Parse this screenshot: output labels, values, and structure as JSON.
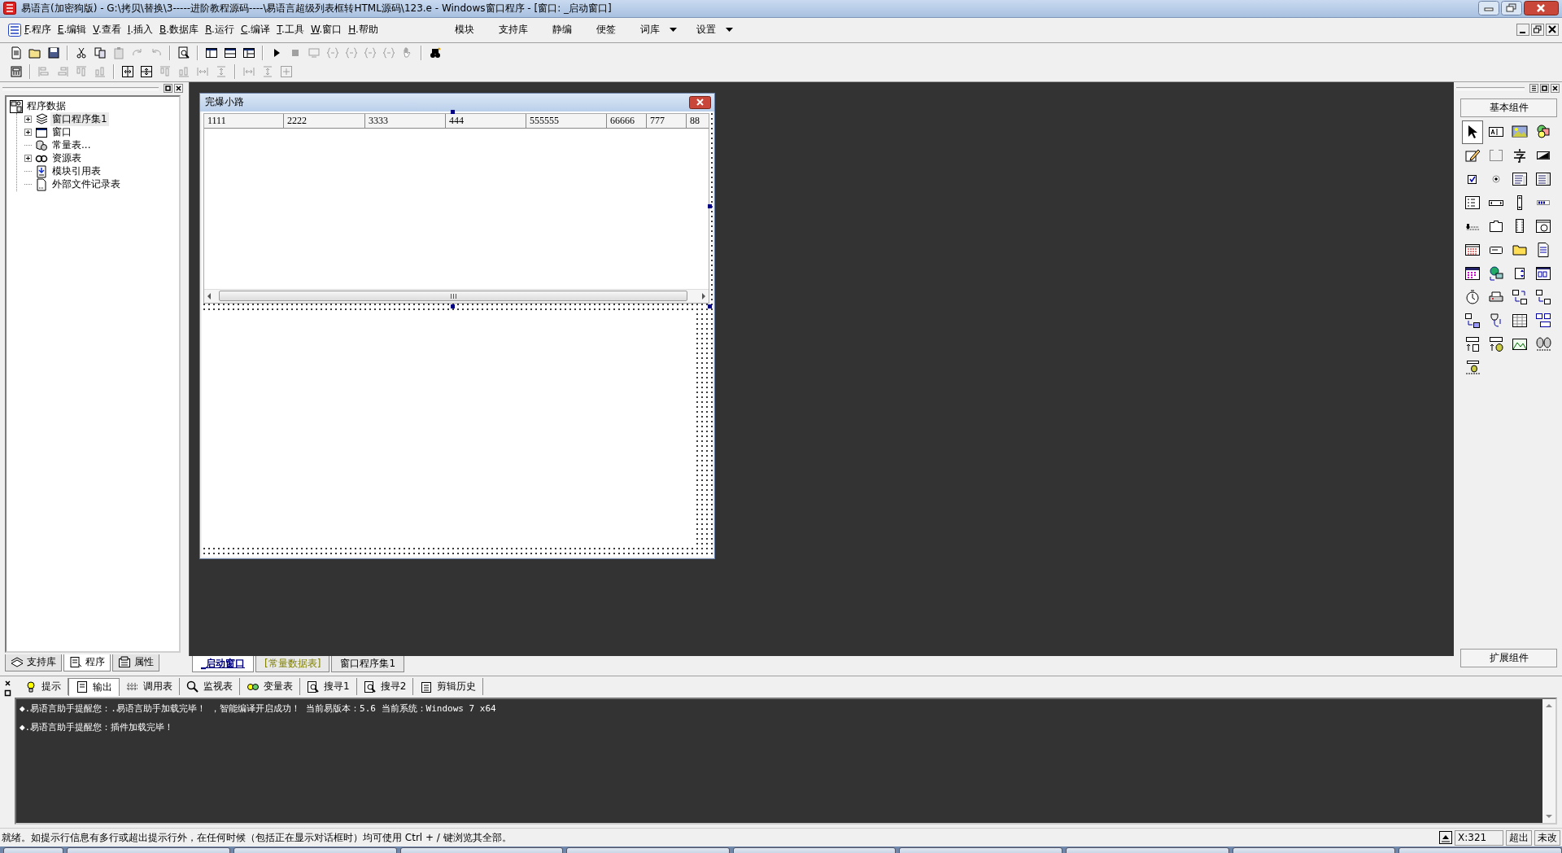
{
  "window": {
    "title": "易语言(加密狗版) - G:\\拷贝\\替换\\3-----进阶教程源码----\\易语言超级列表框转HTML源码\\123.e - Windows窗口程序 - [窗口: _启动窗口]"
  },
  "menu": [
    {
      "key": "F",
      "label": ".程序"
    },
    {
      "key": "E",
      "label": ".编辑"
    },
    {
      "key": "V",
      "label": ".查看"
    },
    {
      "key": "I",
      "label": ".插入"
    },
    {
      "key": "B",
      "label": ".数据库"
    },
    {
      "key": "R",
      "label": ".运行"
    },
    {
      "key": "C",
      "label": ".编译"
    },
    {
      "key": "T",
      "label": ".工具"
    },
    {
      "key": "W",
      "label": ".窗口"
    },
    {
      "key": "H",
      "label": ".帮助"
    }
  ],
  "menu_right": [
    {
      "label": "模块",
      "dropdown": false
    },
    {
      "label": "支持库",
      "dropdown": false
    },
    {
      "label": "静编",
      "dropdown": false
    },
    {
      "label": "便签",
      "dropdown": false
    },
    {
      "label": "词库",
      "dropdown": true
    },
    {
      "label": "设置",
      "dropdown": true
    }
  ],
  "toolbar_1": [
    {
      "disabled": false
    },
    {
      "disabled": false
    },
    {
      "disabled": false
    },
    {
      "disabled": false
    },
    {
      "disabled": false
    },
    {
      "disabled": true
    },
    {
      "disabled": true
    },
    {
      "disabled": true
    },
    {
      "disabled": false
    },
    {
      "disabled": false
    },
    {
      "disabled": false
    },
    {
      "disabled": false
    },
    {
      "disabled": false
    },
    {
      "disabled": true
    },
    {
      "disabled": true
    },
    {
      "disabled": true
    },
    {
      "disabled": true
    },
    {
      "disabled": true
    },
    {
      "disabled": true
    },
    {
      "disabled": true
    },
    {
      "disabled": false
    }
  ],
  "toolbar_2": [
    {
      "disabled": false
    },
    {
      "disabled": true
    },
    {
      "disabled": true
    },
    {
      "disabled": true
    },
    {
      "disabled": true
    },
    {
      "disabled": false
    },
    {
      "disabled": false
    },
    {
      "disabled": true
    },
    {
      "disabled": true
    },
    {
      "disabled": true
    },
    {
      "disabled": true
    },
    {
      "disabled": true
    },
    {
      "disabled": true
    },
    {
      "disabled": true
    }
  ],
  "tree": {
    "label": "程序数据",
    "expanded": true,
    "children": [
      {
        "label": "窗口程序集1",
        "expanded": false,
        "selected": true
      },
      {
        "label": "窗口",
        "expanded": false,
        "selected": false
      },
      {
        "label": "常量表...",
        "selected": false
      },
      {
        "label": "资源表",
        "expanded": false,
        "selected": false
      },
      {
        "label": "模块引用表",
        "selected": false
      },
      {
        "label": "外部文件记录表",
        "selected": false
      }
    ]
  },
  "left_tabs": [
    {
      "label": "支持库",
      "selected": false
    },
    {
      "label": "程序",
      "selected": true
    },
    {
      "label": "属性",
      "selected": false
    }
  ],
  "designer": {
    "title": "完爆小路",
    "list_columns": [
      "1111",
      "2222",
      "3333",
      "444",
      "555555",
      "66666",
      "777",
      "88"
    ]
  },
  "document_tabs": [
    {
      "label": "_启动窗口",
      "selected": true,
      "color": "#000080"
    },
    {
      "label": "[常量数据表]",
      "selected": false,
      "color": "#808000"
    },
    {
      "label": "窗口程序集1",
      "selected": false,
      "color": "#000000"
    }
  ],
  "toolbox": {
    "title": "基本组件",
    "footer": "扩展组件"
  },
  "output_tabs": [
    {
      "label": "提示",
      "selected": false
    },
    {
      "label": "输出",
      "selected": true
    },
    {
      "label": "调用表",
      "selected": false
    },
    {
      "label": "监视表",
      "selected": false
    },
    {
      "label": "变量表",
      "selected": false
    },
    {
      "label": "搜寻1",
      "selected": false
    },
    {
      "label": "搜寻2",
      "selected": false
    },
    {
      "label": "剪辑历史",
      "selected": false
    }
  ],
  "output_lines": [
    "◆.易语言助手提醒您：.易语言助手加载完毕！ ，智能编译开启成功！  当前易版本：5.6  当前系统：Windows 7 x64",
    "◆.易语言助手提醒您：插件加载完毕！"
  ],
  "status_bar": {
    "message": "就绪。如提示行信息有多行或超出提示行外，在任何时候（包括正在显示对话框时）均可使用 Ctrl + / 键浏览其全部。",
    "position": "X:321",
    "overflow": "超出",
    "modified": "未改"
  }
}
